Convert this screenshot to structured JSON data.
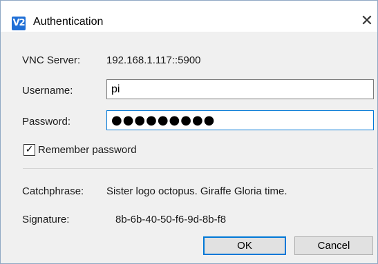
{
  "window": {
    "title": "Authentication",
    "app_icon": "vnc-viewer-icon",
    "app_icon_text": "V2",
    "close_icon": "close-icon"
  },
  "server": {
    "label": "VNC Server:",
    "value": "192.168.1.117::5900"
  },
  "username": {
    "label": "Username:",
    "value": "pi"
  },
  "password": {
    "label": "Password:",
    "masked_value": "●●●●●●●●●"
  },
  "remember": {
    "label": "Remember password",
    "checked": true,
    "check_glyph": "✓"
  },
  "catchphrase": {
    "label": "Catchphrase:",
    "value": "Sister logo octopus. Giraffe Gloria time."
  },
  "signature": {
    "label": "Signature:",
    "value": "8b-6b-40-50-f6-9d-8b-f8"
  },
  "buttons": {
    "ok": "OK",
    "cancel": "Cancel"
  },
  "colors": {
    "accent": "#0078d7",
    "app_icon_bg": "#1f6fd6"
  }
}
